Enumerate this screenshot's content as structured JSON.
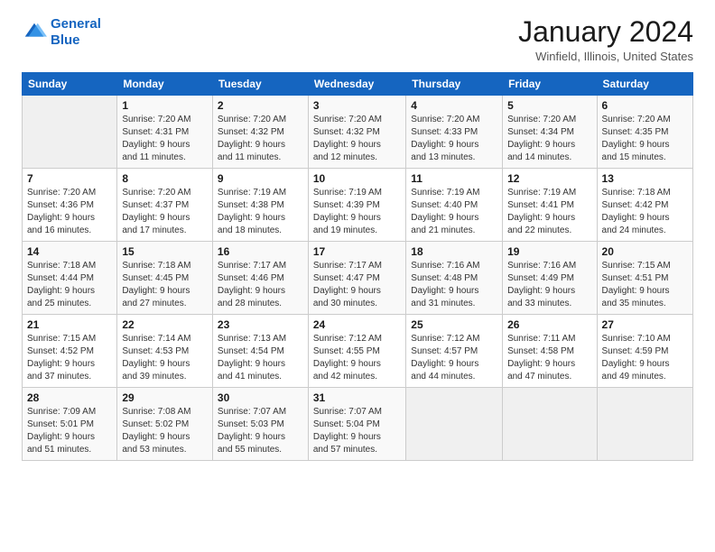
{
  "logo": {
    "line1": "General",
    "line2": "Blue"
  },
  "title": "January 2024",
  "subtitle": "Winfield, Illinois, United States",
  "days_of_week": [
    "Sunday",
    "Monday",
    "Tuesday",
    "Wednesday",
    "Thursday",
    "Friday",
    "Saturday"
  ],
  "weeks": [
    [
      {
        "num": "",
        "info": ""
      },
      {
        "num": "1",
        "info": "Sunrise: 7:20 AM\nSunset: 4:31 PM\nDaylight: 9 hours\nand 11 minutes."
      },
      {
        "num": "2",
        "info": "Sunrise: 7:20 AM\nSunset: 4:32 PM\nDaylight: 9 hours\nand 11 minutes."
      },
      {
        "num": "3",
        "info": "Sunrise: 7:20 AM\nSunset: 4:32 PM\nDaylight: 9 hours\nand 12 minutes."
      },
      {
        "num": "4",
        "info": "Sunrise: 7:20 AM\nSunset: 4:33 PM\nDaylight: 9 hours\nand 13 minutes."
      },
      {
        "num": "5",
        "info": "Sunrise: 7:20 AM\nSunset: 4:34 PM\nDaylight: 9 hours\nand 14 minutes."
      },
      {
        "num": "6",
        "info": "Sunrise: 7:20 AM\nSunset: 4:35 PM\nDaylight: 9 hours\nand 15 minutes."
      }
    ],
    [
      {
        "num": "7",
        "info": "Sunrise: 7:20 AM\nSunset: 4:36 PM\nDaylight: 9 hours\nand 16 minutes."
      },
      {
        "num": "8",
        "info": "Sunrise: 7:20 AM\nSunset: 4:37 PM\nDaylight: 9 hours\nand 17 minutes."
      },
      {
        "num": "9",
        "info": "Sunrise: 7:19 AM\nSunset: 4:38 PM\nDaylight: 9 hours\nand 18 minutes."
      },
      {
        "num": "10",
        "info": "Sunrise: 7:19 AM\nSunset: 4:39 PM\nDaylight: 9 hours\nand 19 minutes."
      },
      {
        "num": "11",
        "info": "Sunrise: 7:19 AM\nSunset: 4:40 PM\nDaylight: 9 hours\nand 21 minutes."
      },
      {
        "num": "12",
        "info": "Sunrise: 7:19 AM\nSunset: 4:41 PM\nDaylight: 9 hours\nand 22 minutes."
      },
      {
        "num": "13",
        "info": "Sunrise: 7:18 AM\nSunset: 4:42 PM\nDaylight: 9 hours\nand 24 minutes."
      }
    ],
    [
      {
        "num": "14",
        "info": "Sunrise: 7:18 AM\nSunset: 4:44 PM\nDaylight: 9 hours\nand 25 minutes."
      },
      {
        "num": "15",
        "info": "Sunrise: 7:18 AM\nSunset: 4:45 PM\nDaylight: 9 hours\nand 27 minutes."
      },
      {
        "num": "16",
        "info": "Sunrise: 7:17 AM\nSunset: 4:46 PM\nDaylight: 9 hours\nand 28 minutes."
      },
      {
        "num": "17",
        "info": "Sunrise: 7:17 AM\nSunset: 4:47 PM\nDaylight: 9 hours\nand 30 minutes."
      },
      {
        "num": "18",
        "info": "Sunrise: 7:16 AM\nSunset: 4:48 PM\nDaylight: 9 hours\nand 31 minutes."
      },
      {
        "num": "19",
        "info": "Sunrise: 7:16 AM\nSunset: 4:49 PM\nDaylight: 9 hours\nand 33 minutes."
      },
      {
        "num": "20",
        "info": "Sunrise: 7:15 AM\nSunset: 4:51 PM\nDaylight: 9 hours\nand 35 minutes."
      }
    ],
    [
      {
        "num": "21",
        "info": "Sunrise: 7:15 AM\nSunset: 4:52 PM\nDaylight: 9 hours\nand 37 minutes."
      },
      {
        "num": "22",
        "info": "Sunrise: 7:14 AM\nSunset: 4:53 PM\nDaylight: 9 hours\nand 39 minutes."
      },
      {
        "num": "23",
        "info": "Sunrise: 7:13 AM\nSunset: 4:54 PM\nDaylight: 9 hours\nand 41 minutes."
      },
      {
        "num": "24",
        "info": "Sunrise: 7:12 AM\nSunset: 4:55 PM\nDaylight: 9 hours\nand 42 minutes."
      },
      {
        "num": "25",
        "info": "Sunrise: 7:12 AM\nSunset: 4:57 PM\nDaylight: 9 hours\nand 44 minutes."
      },
      {
        "num": "26",
        "info": "Sunrise: 7:11 AM\nSunset: 4:58 PM\nDaylight: 9 hours\nand 47 minutes."
      },
      {
        "num": "27",
        "info": "Sunrise: 7:10 AM\nSunset: 4:59 PM\nDaylight: 9 hours\nand 49 minutes."
      }
    ],
    [
      {
        "num": "28",
        "info": "Sunrise: 7:09 AM\nSunset: 5:01 PM\nDaylight: 9 hours\nand 51 minutes."
      },
      {
        "num": "29",
        "info": "Sunrise: 7:08 AM\nSunset: 5:02 PM\nDaylight: 9 hours\nand 53 minutes."
      },
      {
        "num": "30",
        "info": "Sunrise: 7:07 AM\nSunset: 5:03 PM\nDaylight: 9 hours\nand 55 minutes."
      },
      {
        "num": "31",
        "info": "Sunrise: 7:07 AM\nSunset: 5:04 PM\nDaylight: 9 hours\nand 57 minutes."
      },
      {
        "num": "",
        "info": ""
      },
      {
        "num": "",
        "info": ""
      },
      {
        "num": "",
        "info": ""
      }
    ]
  ]
}
